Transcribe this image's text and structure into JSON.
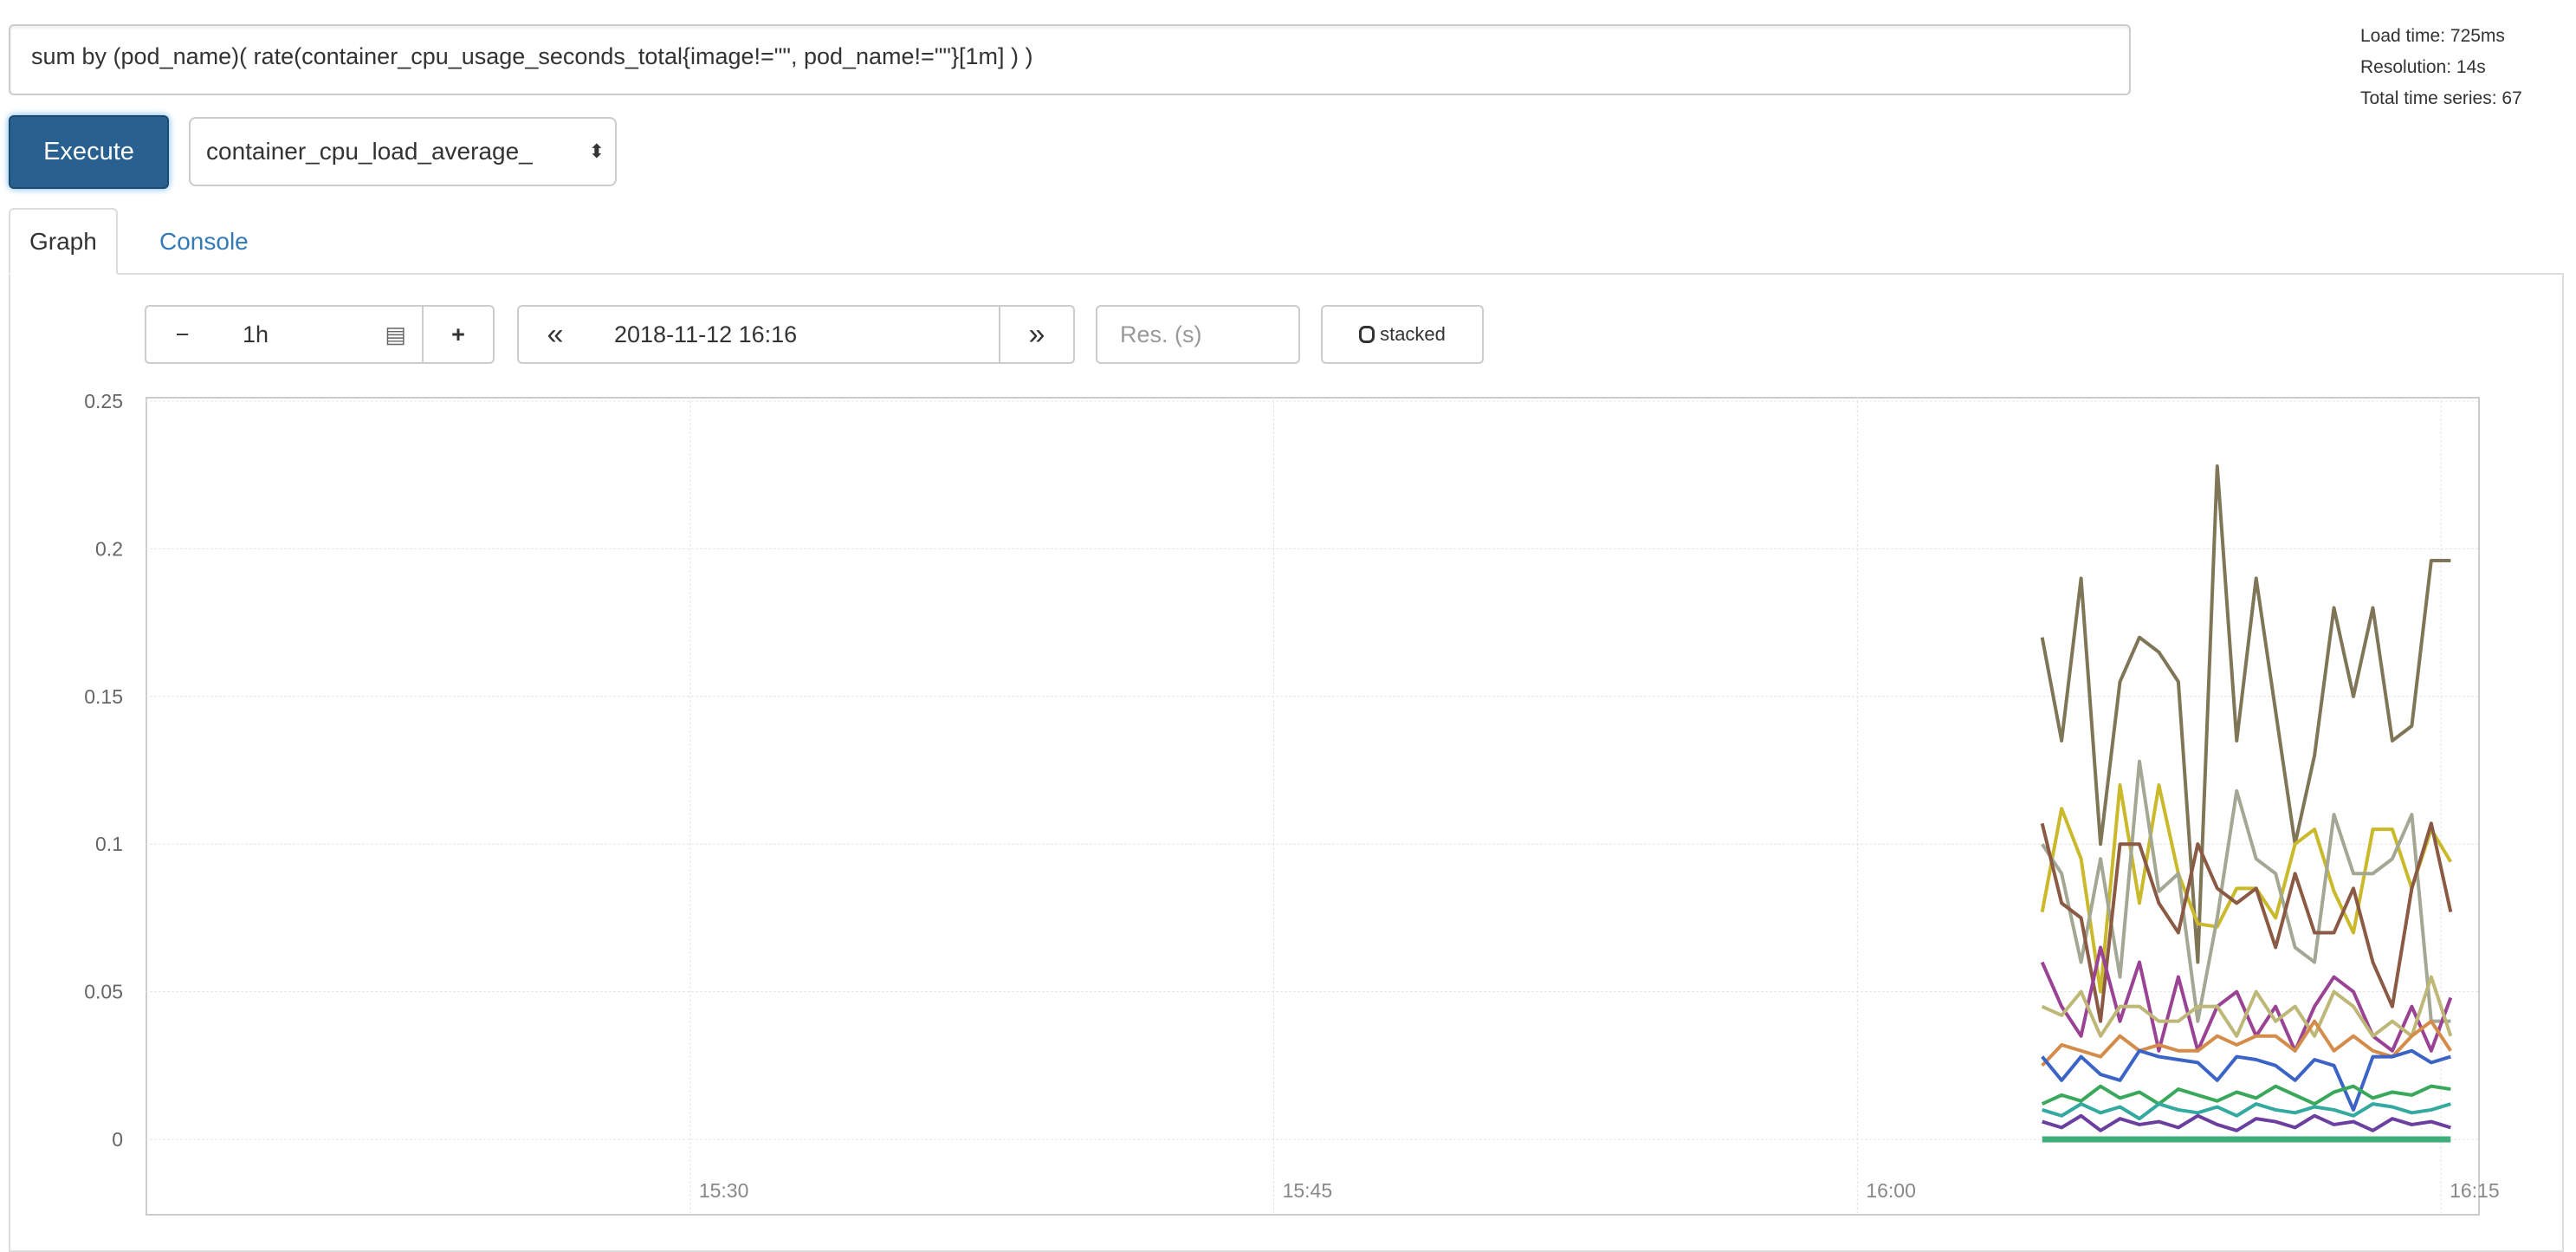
{
  "query": {
    "value": "sum by (pod_name)( rate(container_cpu_usage_seconds_total{image!=\"\", pod_name!=\"\"}[1m] ) )"
  },
  "stats": {
    "load_time": "Load time: 725ms",
    "resolution": "Resolution: 14s",
    "total_series": "Total time series: 67"
  },
  "controls": {
    "execute_label": "Execute",
    "metric_select": "container_cpu_load_average_"
  },
  "tabs": [
    {
      "label": "Graph",
      "active": true
    },
    {
      "label": "Console",
      "active": false
    }
  ],
  "toolbar": {
    "minus": "−",
    "range": "1h",
    "plus": "+",
    "back": "«",
    "end_time": "2018-11-12 16:16",
    "forward": "»",
    "resolution_placeholder": "Res. (s)",
    "stacked_label": "stacked"
  },
  "chart_data": {
    "type": "line",
    "xlim": [
      "15:16",
      "16:16"
    ],
    "ylim": [
      0,
      0.25
    ],
    "grid": true,
    "y_ticks": [
      "0",
      "0.05",
      "0.1",
      "0.15",
      "0.2",
      "0.25"
    ],
    "x_ticks": [
      "15:30",
      "15:45",
      "16:00",
      "16:15"
    ],
    "x": [
      "16:04:45",
      "16:05:15",
      "16:05:45",
      "16:06:15",
      "16:06:45",
      "16:07:15",
      "16:07:45",
      "16:08:15",
      "16:08:45",
      "16:09:15",
      "16:09:45",
      "16:10:15",
      "16:10:45",
      "16:11:15",
      "16:11:45",
      "16:12:15",
      "16:12:45",
      "16:13:15",
      "16:13:45",
      "16:14:15",
      "16:14:45",
      "16:15:15"
    ],
    "series": [
      {
        "color": "#7f7557",
        "values": [
          0.17,
          0.135,
          0.19,
          0.1,
          0.155,
          0.17,
          0.165,
          0.155,
          0.06,
          0.228,
          0.135,
          0.19,
          0.145,
          0.1,
          0.13,
          0.18,
          0.15,
          0.18,
          0.135,
          0.14,
          0.196,
          0.196
        ]
      },
      {
        "color": "#c9b92b",
        "values": [
          0.077,
          0.112,
          0.095,
          0.05,
          0.12,
          0.08,
          0.12,
          0.09,
          0.073,
          0.072,
          0.085,
          0.085,
          0.075,
          0.1,
          0.105,
          0.084,
          0.07,
          0.105,
          0.105,
          0.085,
          0.105,
          0.094
        ]
      },
      {
        "color": "#a3a894",
        "values": [
          0.1,
          0.09,
          0.06,
          0.095,
          0.055,
          0.128,
          0.084,
          0.09,
          0.04,
          0.075,
          0.118,
          0.095,
          0.09,
          0.065,
          0.06,
          0.11,
          0.09,
          0.09,
          0.095,
          0.11,
          0.04,
          0.04
        ]
      },
      {
        "color": "#8a5a44",
        "values": [
          0.107,
          0.08,
          0.075,
          0.04,
          0.1,
          0.1,
          0.08,
          0.07,
          0.1,
          0.085,
          0.08,
          0.085,
          0.065,
          0.09,
          0.07,
          0.07,
          0.085,
          0.06,
          0.045,
          0.085,
          0.107,
          0.077
        ]
      },
      {
        "color": "#9a4394",
        "values": [
          0.06,
          0.045,
          0.035,
          0.065,
          0.04,
          0.06,
          0.03,
          0.055,
          0.03,
          0.045,
          0.05,
          0.035,
          0.045,
          0.03,
          0.045,
          0.055,
          0.05,
          0.035,
          0.03,
          0.045,
          0.03,
          0.048
        ]
      },
      {
        "color": "#bdb877",
        "values": [
          0.045,
          0.042,
          0.05,
          0.035,
          0.045,
          0.045,
          0.04,
          0.04,
          0.045,
          0.045,
          0.035,
          0.05,
          0.04,
          0.045,
          0.035,
          0.05,
          0.045,
          0.035,
          0.04,
          0.035,
          0.055,
          0.035
        ]
      },
      {
        "color": "#d48c4a",
        "values": [
          0.025,
          0.032,
          0.03,
          0.028,
          0.035,
          0.03,
          0.032,
          0.03,
          0.03,
          0.035,
          0.032,
          0.035,
          0.035,
          0.03,
          0.04,
          0.03,
          0.035,
          0.03,
          0.028,
          0.035,
          0.04,
          0.03
        ]
      },
      {
        "color": "#3c63c6",
        "values": [
          0.028,
          0.02,
          0.028,
          0.022,
          0.02,
          0.03,
          0.028,
          0.027,
          0.026,
          0.02,
          0.028,
          0.027,
          0.025,
          0.02,
          0.027,
          0.025,
          0.01,
          0.028,
          0.028,
          0.03,
          0.026,
          0.028
        ]
      },
      {
        "color": "#3aa85a",
        "values": [
          0.012,
          0.015,
          0.013,
          0.018,
          0.014,
          0.016,
          0.012,
          0.017,
          0.015,
          0.013,
          0.016,
          0.014,
          0.018,
          0.015,
          0.012,
          0.016,
          0.018,
          0.014,
          0.016,
          0.015,
          0.018,
          0.017
        ]
      },
      {
        "color": "#33a9a0",
        "values": [
          0.01,
          0.008,
          0.012,
          0.009,
          0.011,
          0.007,
          0.012,
          0.01,
          0.009,
          0.011,
          0.008,
          0.012,
          0.01,
          0.009,
          0.011,
          0.01,
          0.008,
          0.012,
          0.011,
          0.009,
          0.01,
          0.012
        ]
      },
      {
        "color": "#6a3fa0",
        "values": [
          0.006,
          0.004,
          0.008,
          0.003,
          0.007,
          0.005,
          0.006,
          0.004,
          0.008,
          0.005,
          0.003,
          0.007,
          0.006,
          0.004,
          0.008,
          0.005,
          0.006,
          0.003,
          0.007,
          0.005,
          0.006,
          0.004
        ]
      },
      {
        "color": "#3fae7a",
        "values": [
          0,
          0,
          0,
          0,
          0,
          0,
          0,
          0,
          0,
          0,
          0,
          0,
          0,
          0,
          0,
          0,
          0,
          0,
          0,
          0,
          0,
          0
        ]
      }
    ]
  }
}
